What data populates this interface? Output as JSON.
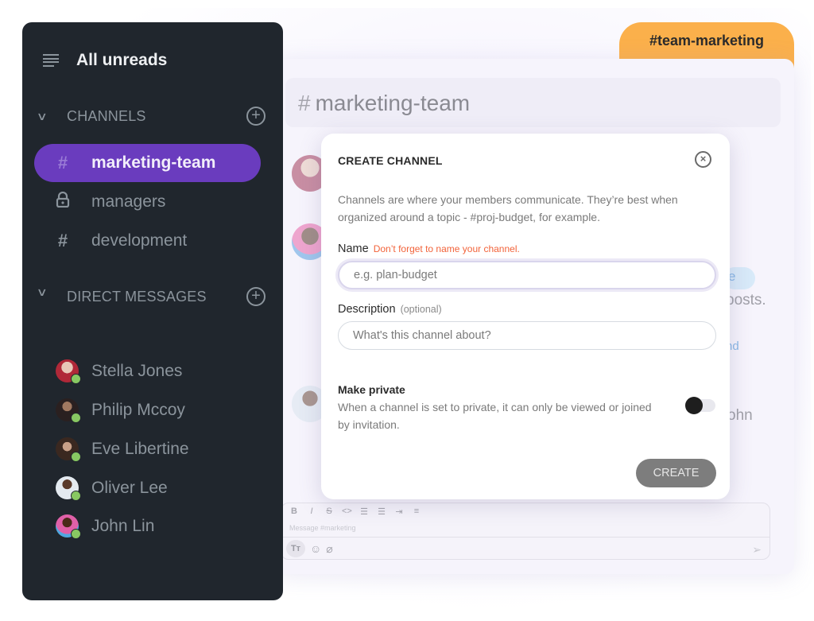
{
  "tag": {
    "label": "#team-marketing",
    "color": "#fbb04b"
  },
  "sidebar": {
    "all_unreads": "All unreads",
    "channels_header": "CHANNELS",
    "channels": [
      {
        "icon": "#",
        "icon_name": "hash-icon",
        "label": "marketing-team",
        "active": true
      },
      {
        "icon": "lock",
        "icon_name": "lock-icon",
        "label": "managers",
        "active": false
      },
      {
        "icon": "#",
        "icon_name": "hash-icon",
        "label": "development",
        "active": false
      }
    ],
    "dm_header": "DIRECT MESSAGES",
    "direct_messages": [
      {
        "name": "Stella Jones",
        "status": "online"
      },
      {
        "name": "Philip Mccoy",
        "status": "online"
      },
      {
        "name": "Eve Libertine",
        "status": "online"
      },
      {
        "name": "Oliver Lee",
        "status": "online"
      },
      {
        "name": "John Lin",
        "status": "online"
      }
    ],
    "accent": "#6a3cbe"
  },
  "channel_view": {
    "hash": "#",
    "title": "marketing-team",
    "bg_fragments": {
      "pill": "e",
      "posts": "posts.",
      "link": "nd",
      "john": "ohn"
    },
    "composer": {
      "toolbar": [
        "B",
        "I",
        "S",
        "<>",
        "ordered-list",
        "bullet-list",
        "indent",
        "code-block"
      ],
      "placeholder": "Message #marketing",
      "text_format": "Tт"
    }
  },
  "modal": {
    "title": "CREATE CHANNEL",
    "description": "Channels are where your members communicate. They’re best when organized around a topic - #proj-budget, for example.",
    "name_label": "Name",
    "name_warning": "Don’t forget to name your channel.",
    "name_placeholder": "e.g. plan-budget",
    "name_value": "",
    "description_label": "Description",
    "description_optional": "(optional)",
    "description_placeholder": "What's this channel about?",
    "description_value": "",
    "private_title": "Make private",
    "private_desc": "When a channel is set to private, it can only be viewed or joined by invitation.",
    "private_enabled": false,
    "create_label": "CREATE"
  }
}
